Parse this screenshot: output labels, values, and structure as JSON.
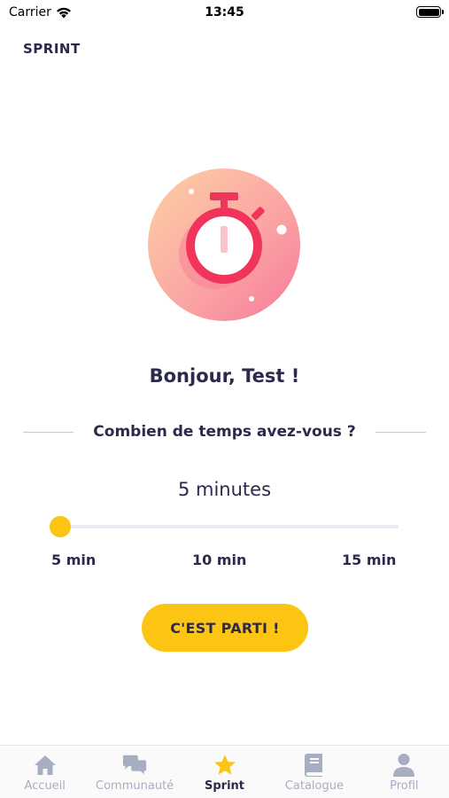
{
  "status_bar": {
    "carrier": "Carrier",
    "time": "13:45"
  },
  "header": {
    "title": "SPRINT"
  },
  "greeting": "Bonjour, Test !",
  "question": "Combien de temps avez-vous ?",
  "duration": {
    "label": "5 minutes",
    "value_min": 5,
    "min": 5,
    "max": 15
  },
  "ticks": [
    "5 min",
    "10 min",
    "15 min"
  ],
  "start_button": "C'EST PARTI !",
  "tabs": [
    {
      "label": "Accueil",
      "icon": "home-icon",
      "active": false
    },
    {
      "label": "Communauté",
      "icon": "chat-bubbles-icon",
      "active": false
    },
    {
      "label": "Sprint",
      "icon": "star-icon",
      "active": true
    },
    {
      "label": "Catalogue",
      "icon": "book-icon",
      "active": false
    },
    {
      "label": "Profil",
      "icon": "person-icon",
      "active": false
    }
  ],
  "colors": {
    "accent": "#fdc513",
    "text": "#2b2a4c",
    "inactive_tab": "#a7aec2",
    "hero_pink": "#f2456a"
  }
}
